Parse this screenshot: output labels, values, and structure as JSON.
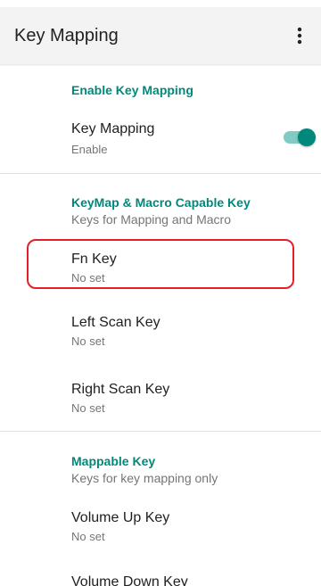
{
  "app_bar": {
    "title": "Key Mapping",
    "overflow_icon": "more-vert-icon"
  },
  "sections": {
    "enable": {
      "category": "Enable Key Mapping",
      "key_mapping": {
        "title": "Key Mapping",
        "summary": "Enable",
        "toggle_on": true
      }
    },
    "keymap_macro": {
      "category": "KeyMap & Macro Capable Key",
      "subtitle": "Keys for Mapping and Macro",
      "items": [
        {
          "title": "Fn Key",
          "summary": "No set"
        },
        {
          "title": "Left Scan Key",
          "summary": "No set"
        },
        {
          "title": "Right Scan Key",
          "summary": "No set"
        }
      ]
    },
    "mappable": {
      "category": "Mappable Key",
      "subtitle": "Keys for key mapping only",
      "items": [
        {
          "title": "Volume Up Key",
          "summary": "No set"
        },
        {
          "title": "Volume Down Key",
          "summary": ""
        }
      ]
    }
  },
  "colors": {
    "accent": "#00897b",
    "accent_track": "#80cbc4",
    "highlight": "#e3202a",
    "app_bar_bg": "#f3f3f3"
  }
}
